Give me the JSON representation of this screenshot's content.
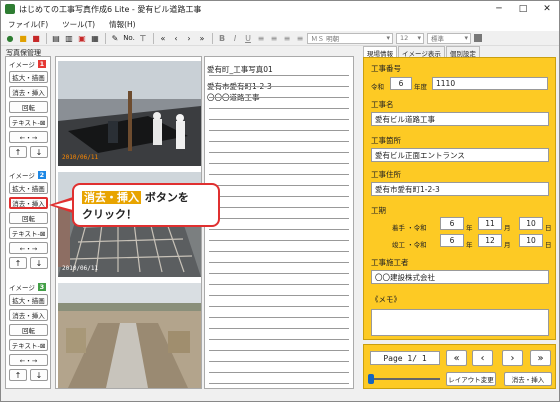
{
  "window": {
    "title": "はじめての工事写真作成6 Lite - 愛有ビル道路工事"
  },
  "menu": {
    "file": "ファイル(F)",
    "tool": "ツール(T)",
    "info": "情報(H)"
  },
  "toolbar": {
    "no_label": "No.",
    "font": "ＭＳ 明朝",
    "size": "12",
    "style": "標準"
  },
  "left": {
    "heading": "写真保管理",
    "groups": [
      {
        "label": "イメージ",
        "num": "1",
        "zoom": "拡大・描画",
        "erase": "消去・挿入",
        "rotate": "回転",
        "text": "テキスト-⊠",
        "move": "←・→"
      },
      {
        "label": "イメージ",
        "num": "2",
        "zoom": "拡大・描画",
        "erase": "消去・挿入",
        "rotate": "回転",
        "text": "テキスト-⊠",
        "move": "←・→"
      },
      {
        "label": "イメージ",
        "num": "3",
        "zoom": "拡大・描画",
        "erase": "消去・挿入",
        "rotate": "回転",
        "text": "テキスト-⊠",
        "move": "←・→"
      }
    ]
  },
  "photos": [
    {
      "stamp": "2010/06/11"
    },
    {
      "stamp": "2010/06/11"
    },
    {
      "stamp": ""
    }
  ],
  "caption1": {
    "line1": "愛有町_工事写真01",
    "line2": "愛有市愛有町1-2-3",
    "line3": "〇〇〇道路工事"
  },
  "tabs": {
    "t1": "現場情報",
    "t2": "イメージ表示",
    "t3": "個別設定"
  },
  "info": {
    "no_label": "工事番号",
    "era": "令和",
    "year": "6",
    "year_unit": "年度",
    "no_value": "1110",
    "name_label": "工事名",
    "name_value": "愛有ビル道路工事",
    "place_label": "工事箇所",
    "place_value": "愛有ビル正面エントランス",
    "addr_label": "工事住所",
    "addr_value": "愛有市愛有町1-2-3",
    "period_label": "工期",
    "start_label": "着手 ・令和",
    "start_y": "6",
    "start_m": "11",
    "start_d": "10",
    "end_label": "竣工 ・令和",
    "end_y": "6",
    "end_m": "12",
    "end_d": "10",
    "unit_y": "年",
    "unit_m": "月",
    "unit_d": "日",
    "contractor_label": "工事施工者",
    "contractor_value": "〇〇建設株式会社",
    "memo_label": "《メモ》"
  },
  "bottom": {
    "page": "Page 1/ 1",
    "layout": "レイアウト変更",
    "erase": "消去・挿入"
  },
  "callout": {
    "kw": "消去・挿入",
    "rest": "ボタンを",
    "line2": "クリック！"
  },
  "colors": {
    "accent_red": "#e03030",
    "panel_yellow": "#fdca24",
    "num1": "#e53935",
    "num2": "#1e88e5",
    "num3": "#43a047"
  }
}
